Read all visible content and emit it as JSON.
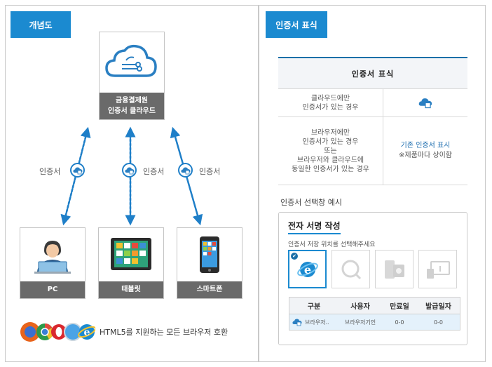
{
  "left": {
    "section_tag": "개념도",
    "cloud_label_line1": "금융결제원",
    "cloud_label_line2": "인증서 클라우드",
    "flow_label": "인증서",
    "devices": [
      {
        "label": "PC",
        "icon": "pc-user-icon"
      },
      {
        "label": "태블릿",
        "icon": "tablet-icon"
      },
      {
        "label": "스마트폰",
        "icon": "smartphone-icon"
      }
    ],
    "browser_text": "HTML5를 지원하는 모든 브라우저 호환"
  },
  "right": {
    "section_tag": "인증서 표식",
    "table": {
      "header": "인증서 표식",
      "row1_line1": "클라우드에만",
      "row1_line2": "인증서가 있는 경우",
      "row2_line1": "브라우저에만",
      "row2_line2": "인증서가 있는 경우",
      "row2_line3": "또는",
      "row2_line4": "브라우저와 클라우드에",
      "row2_line5": "동일한 인증서가 있는 경우",
      "row2_value": "기존 인증서 표시",
      "row2_note": "※제품마다 상이함"
    },
    "example_label": "인증서 선택창 예시",
    "dialog": {
      "title": "전자 서명 작성",
      "instruction": "인증서 저장 위치를 선택해주세요",
      "list_columns": [
        "구분",
        "사용자",
        "만료일",
        "발급일자"
      ],
      "list_row": [
        "브라우저..",
        "브라우저기인",
        "0-0",
        "0-0"
      ]
    }
  },
  "colors": {
    "accent": "#1b8ad0",
    "dark_label": "#6a6a6a",
    "table_rule": "#1b6fa8"
  }
}
